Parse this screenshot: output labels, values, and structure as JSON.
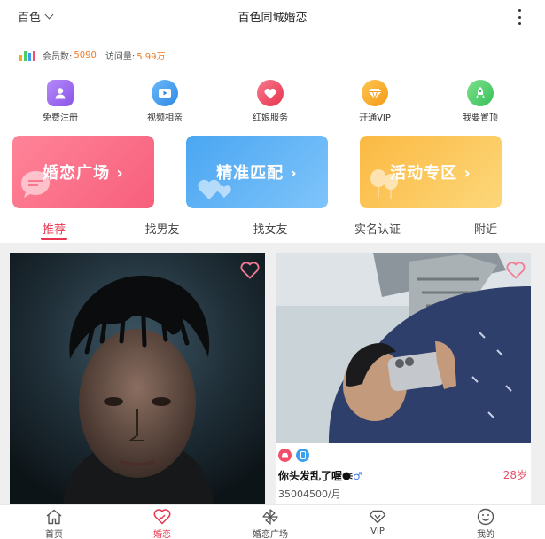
{
  "header": {
    "city": "百色",
    "title": "百色同城婚恋"
  },
  "stats": {
    "members_label": "会员数:",
    "members_value": "5090",
    "visits_label": "访问量:",
    "visits_value": "5.99万"
  },
  "quick_menu": [
    {
      "label": "免费注册",
      "icon": "user-icon",
      "color": "#9b6cf0"
    },
    {
      "label": "视频相亲",
      "icon": "video-icon",
      "color": "#3a9ff0"
    },
    {
      "label": "红娘服务",
      "icon": "heart-icon",
      "color": "#f0506a"
    },
    {
      "label": "开通VIP",
      "icon": "diamond-icon",
      "color": "#f7a823"
    },
    {
      "label": "我要置顶",
      "icon": "rocket-icon",
      "color": "#4ccf6a"
    }
  ],
  "banners": [
    {
      "label": "婚恋广场",
      "arrow": "›",
      "color": "#f8697f"
    },
    {
      "label": "精准匹配",
      "arrow": "›",
      "color": "#55aef5"
    },
    {
      "label": "活动专区",
      "arrow": "›",
      "color": "#fbc95a"
    }
  ],
  "tabs": [
    "推荐",
    "找男友",
    "找女友",
    "实名认证",
    "附近"
  ],
  "active_tab": "推荐",
  "cards": [
    {
      "name": "",
      "age": "",
      "income": ""
    },
    {
      "name": "你头发乱了喔",
      "gender_symbol": "♂",
      "age": "28岁",
      "income": "35004500/月"
    }
  ],
  "bottom_nav": [
    {
      "label": "首页",
      "icon": "home-icon"
    },
    {
      "label": "婚恋",
      "icon": "love-icon"
    },
    {
      "label": "婚恋广场",
      "icon": "pinwheel-icon"
    },
    {
      "label": "VIP",
      "icon": "diamond-icon"
    },
    {
      "label": "我的",
      "icon": "smile-icon"
    }
  ],
  "active_nav": "婚恋",
  "colors": {
    "accent": "#e8344f",
    "stat_number": "#f07a20",
    "male": "#3a7be0"
  }
}
